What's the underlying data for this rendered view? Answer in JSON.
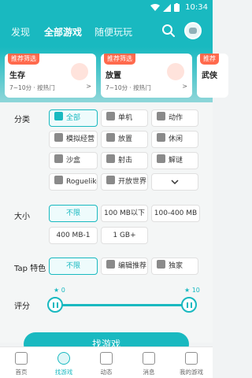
{
  "status_bar": {
    "time": "10:34"
  },
  "header": {
    "tabs": [
      {
        "label": "发现",
        "active": false
      },
      {
        "label": "全部游戏",
        "active": true
      },
      {
        "label": "随便玩玩",
        "active": false
      }
    ]
  },
  "recommend_cards": [
    {
      "badge": "推荐筛选",
      "name": "生存",
      "meta": "7~10分 · 按热门",
      "arrow": ">"
    },
    {
      "badge": "推荐筛选",
      "name": "放置",
      "meta": "7~10分 · 按热门",
      "arrow": ">"
    },
    {
      "badge": "推荐",
      "name": "武侠",
      "meta": "",
      "arrow": ""
    }
  ],
  "filters": {
    "category": {
      "label": "分类",
      "options": [
        {
          "label": "全部",
          "icon": "grid-icon",
          "active": true
        },
        {
          "label": "单机",
          "icon": "gamepad-icon",
          "active": false
        },
        {
          "label": "动作",
          "icon": "sword-icon",
          "active": false
        },
        {
          "label": "模拟经营",
          "icon": "shop-icon",
          "active": false
        },
        {
          "label": "放置",
          "icon": "hourglass-icon",
          "active": false
        },
        {
          "label": "休闲",
          "icon": "smile-icon",
          "active": false
        },
        {
          "label": "沙盒",
          "icon": "sandbox-icon",
          "active": false
        },
        {
          "label": "射击",
          "icon": "target-icon",
          "active": false
        },
        {
          "label": "解谜",
          "icon": "bulb-icon",
          "active": false
        },
        {
          "label": "Roguelike",
          "icon": "dice-icon",
          "active": false
        },
        {
          "label": "开放世界",
          "icon": "globe-icon",
          "active": false
        },
        {
          "label": "",
          "icon": "chevron-down-icon",
          "active": false
        }
      ]
    },
    "size": {
      "label": "大小",
      "options": [
        {
          "label": "不限",
          "active": true
        },
        {
          "label": "100 MB以下",
          "active": false
        },
        {
          "label": "100-400 MB",
          "active": false
        },
        {
          "label": "400 MB-1",
          "active": false
        },
        {
          "label": "1 GB+",
          "active": false
        }
      ]
    },
    "tap_feature": {
      "label": "Tap 特色",
      "options": [
        {
          "label": "不限",
          "icon": "",
          "active": true
        },
        {
          "label": "编辑推荐",
          "icon": "hand-icon",
          "active": false
        },
        {
          "label": "独家",
          "icon": "tap-logo-icon",
          "active": false
        }
      ]
    },
    "rating": {
      "label": "评分",
      "min_label": "★ 0",
      "max_label": "★ 10",
      "min": 0,
      "max": 10
    }
  },
  "find_button": {
    "label": "找游戏"
  },
  "bottom_nav": [
    {
      "label": "首页",
      "icon": "home-icon",
      "active": false
    },
    {
      "label": "找游戏",
      "icon": "planet-icon",
      "active": true
    },
    {
      "label": "动态",
      "icon": "feed-icon",
      "active": false
    },
    {
      "label": "消息",
      "icon": "bell-icon",
      "active": false
    },
    {
      "label": "我的游戏",
      "icon": "controller-icon",
      "active": false
    }
  ],
  "colors": {
    "accent": "#19b9c0",
    "badge": "#ff6a4d"
  }
}
